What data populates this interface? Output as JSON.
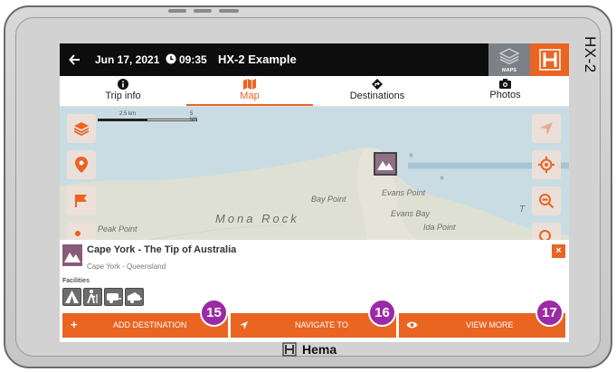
{
  "device": {
    "model_label": "HX-2",
    "brand_label": "Hema"
  },
  "topbar": {
    "date": "Jun 17, 2021",
    "time": "09:35",
    "title": "HX-2 Example",
    "maps_label": "MAPS"
  },
  "tabs": [
    {
      "label": "Trip info",
      "icon": "info-icon"
    },
    {
      "label": "Map",
      "icon": "map-icon",
      "active": true
    },
    {
      "label": "Destinations",
      "icon": "diamond-turn-icon"
    },
    {
      "label": "Photos",
      "icon": "camera-icon"
    }
  ],
  "map": {
    "scale_labels": [
      "2.5 km",
      "5 km"
    ],
    "places": [
      "Bay Point",
      "Evans Point",
      "Evans Bay",
      "Ida Point",
      "Peak Point",
      "Mona Rock",
      "T"
    ]
  },
  "place": {
    "title": "Cape York - The Tip of Australia",
    "subtitle": "Cape York - Queensland",
    "facilities_label": "Facilities",
    "facilities": [
      "camping-icon",
      "hiking-icon",
      "caravan-icon",
      "camper-trailer-icon"
    ],
    "close_label": "×"
  },
  "actions": [
    {
      "label": "ADD DESTINATION",
      "icon": "+",
      "badge": "15"
    },
    {
      "label": "NAVIGATE TO",
      "icon": "navigation-arrow-icon",
      "badge": "16"
    },
    {
      "label": "VIEW MORE",
      "icon": "eye-icon",
      "badge": "17"
    }
  ],
  "colors": {
    "accent": "#ea6422",
    "badge": "#9b2aa6",
    "topbar": "#0d0d0d"
  }
}
